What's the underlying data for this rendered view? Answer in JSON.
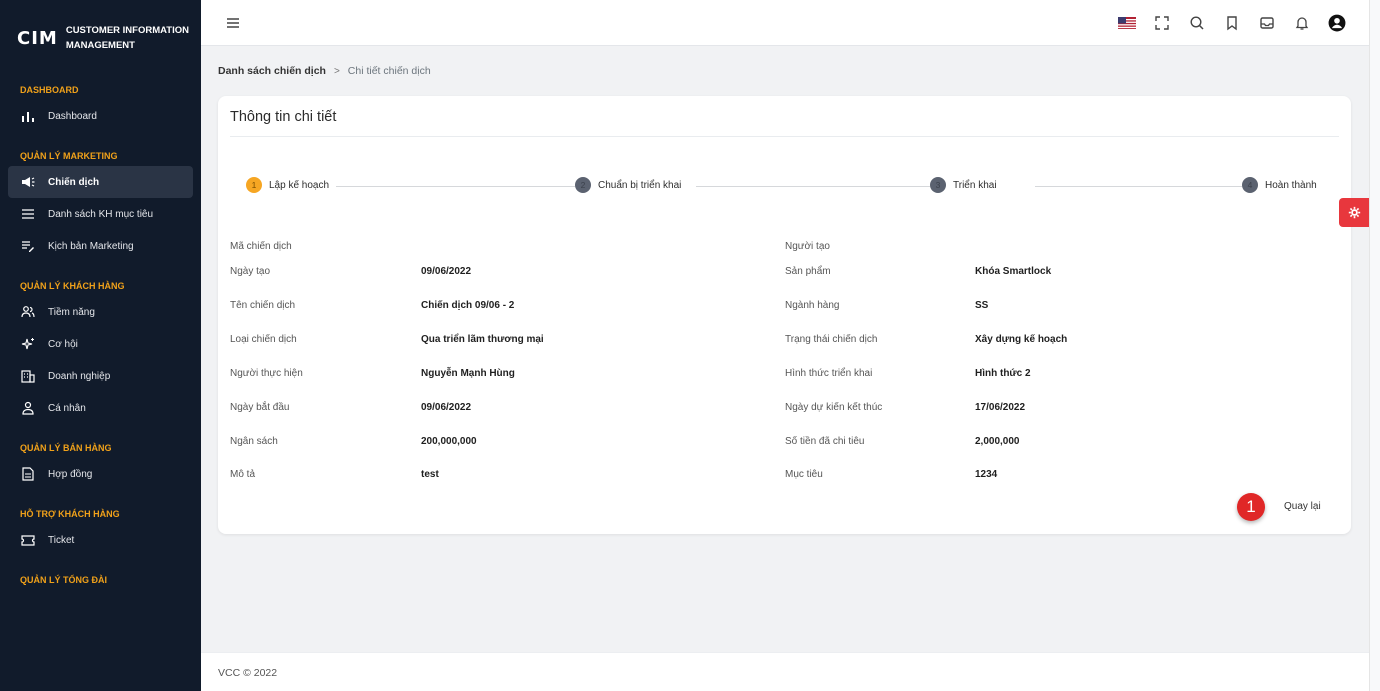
{
  "brand": {
    "logo": "CIM",
    "line1": "CUSTOMER INFORMATION",
    "line2": "MANAGEMENT"
  },
  "sidebar": {
    "sections": [
      {
        "title": "DASHBOARD",
        "items": [
          {
            "label": "Dashboard",
            "icon": "bar-chart-icon"
          }
        ]
      },
      {
        "title": "QUẢN LÝ MARKETING",
        "items": [
          {
            "label": "Chiến dịch",
            "icon": "megaphone-icon",
            "active": true
          },
          {
            "label": "Danh sách KH mục tiêu",
            "icon": "list-icon"
          },
          {
            "label": "Kịch bản Marketing",
            "icon": "edit-list-icon"
          }
        ]
      },
      {
        "title": "QUẢN LÝ KHÁCH HÀNG",
        "items": [
          {
            "label": "Tiềm năng",
            "icon": "users-icon"
          },
          {
            "label": "Cơ hội",
            "icon": "sparkle-icon"
          },
          {
            "label": "Doanh nghiệp",
            "icon": "building-icon"
          },
          {
            "label": "Cá nhân",
            "icon": "user-icon"
          }
        ]
      },
      {
        "title": "QUẢN LÝ BÁN HÀNG",
        "items": [
          {
            "label": "Hợp đồng",
            "icon": "document-icon"
          }
        ]
      },
      {
        "title": "HỖ TRỢ KHÁCH HÀNG",
        "items": [
          {
            "label": "Ticket",
            "icon": "ticket-icon"
          }
        ]
      },
      {
        "title": "QUẢN LÝ TỔNG ĐÀI",
        "items": []
      }
    ]
  },
  "topbar": {
    "icons": [
      "us-flag-icon",
      "fullscreen-icon",
      "search-icon",
      "bookmark-icon",
      "inbox-icon",
      "bell-icon",
      "account-icon"
    ]
  },
  "breadcrumb": {
    "parent": "Danh sách chiến dịch",
    "separator": ">",
    "current": "Chi tiết chiến dịch"
  },
  "card": {
    "title": "Thông tin chi tiết",
    "steps": [
      {
        "num": "1",
        "label": "Lập kế hoạch",
        "current": true
      },
      {
        "num": "2",
        "label": "Chuẩn bị triển khai"
      },
      {
        "num": "3",
        "label": "Triển khai"
      },
      {
        "num": "4",
        "label": "Hoàn thành"
      }
    ],
    "left_fields": [
      {
        "label": "Mã chiến dịch",
        "value": ""
      },
      {
        "label": "Ngày tạo",
        "value": "09/06/2022"
      },
      {
        "label": "Tên chiến dịch",
        "value": "Chiến dịch 09/06 - 2"
      },
      {
        "label": "Loại chiến dịch",
        "value": "Qua triển lãm thương mại"
      },
      {
        "label": "Người thực hiện",
        "value": "Nguyễn Mạnh Hùng"
      },
      {
        "label": "Ngày bắt đầu",
        "value": "09/06/2022"
      },
      {
        "label": "Ngân sách",
        "value": "200,000,000"
      },
      {
        "label": "Mô tả",
        "value": "test"
      }
    ],
    "right_fields": [
      {
        "label": "Người tạo",
        "value": ""
      },
      {
        "label": "Sản phẩm",
        "value": "Khóa Smartlock"
      },
      {
        "label": "Ngành hàng",
        "value": "SS"
      },
      {
        "label": "Trạng thái chiến dịch",
        "value": "Xây dựng kế hoạch"
      },
      {
        "label": "Hình thức triển khai",
        "value": "Hình thức 2"
      },
      {
        "label": "Ngày dự kiến kết thúc",
        "value": "17/06/2022"
      },
      {
        "label": "Số tiền đã chi tiêu",
        "value": "2,000,000"
      },
      {
        "label": "Mục tiêu",
        "value": "1234"
      }
    ],
    "back_label": "Quay lại",
    "annotation_badge": "1"
  },
  "footer": {
    "text": "VCC © 2022"
  },
  "colors": {
    "sidebar_bg": "#111b2b",
    "section_title": "#f0a11a",
    "step_current": "#f6a623",
    "badge": "#e02727",
    "fab": "#e8373d"
  }
}
